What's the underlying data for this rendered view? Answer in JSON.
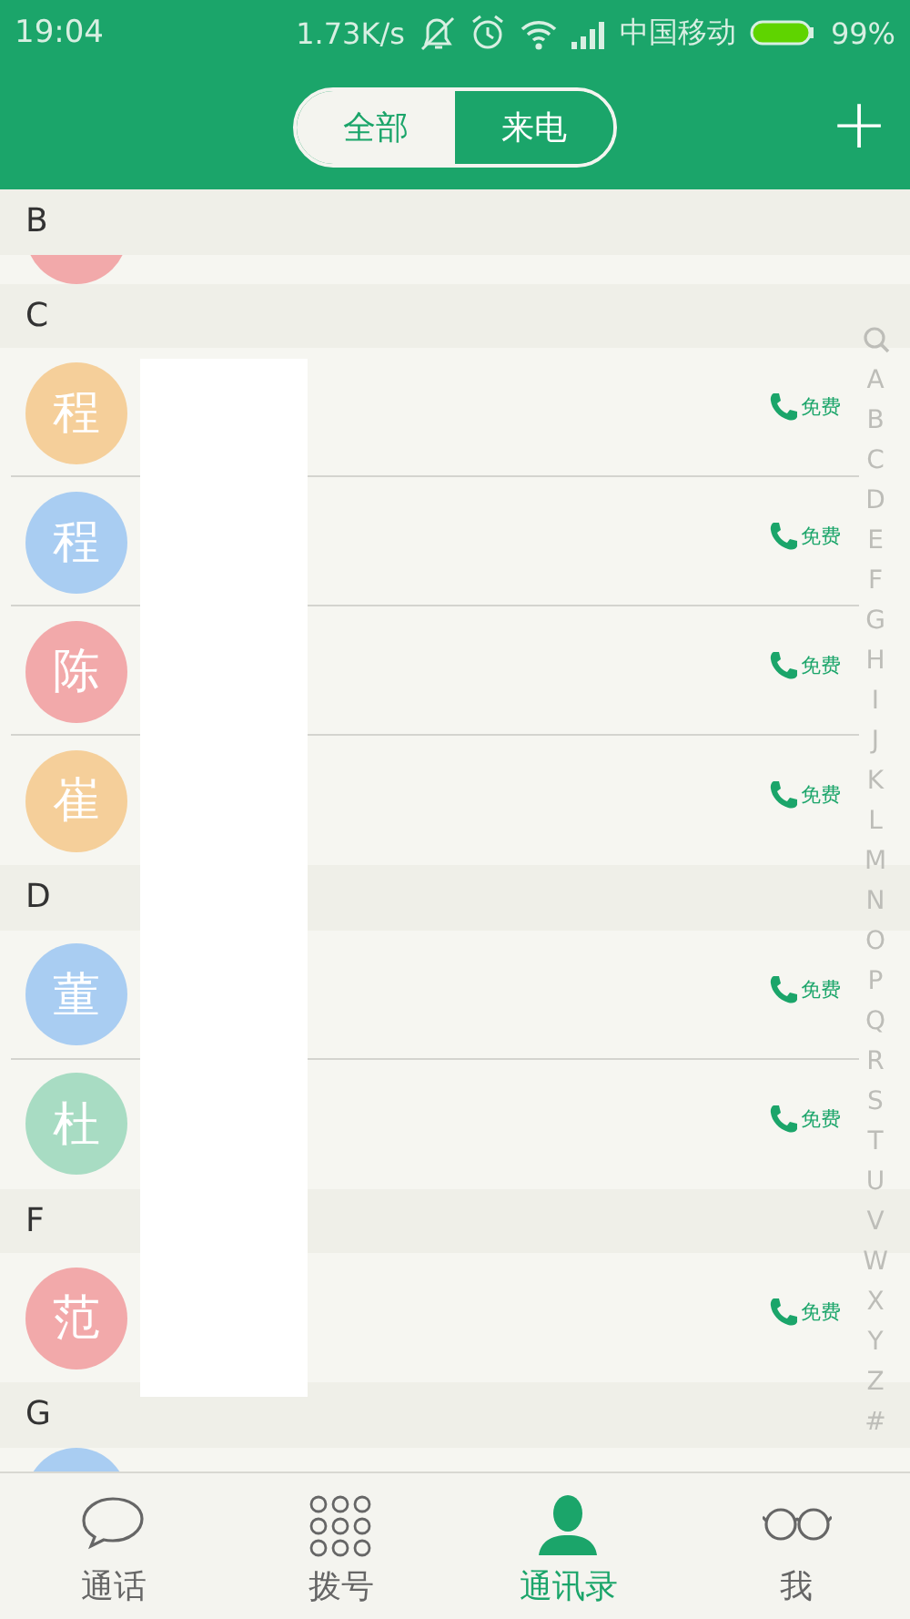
{
  "status_bar": {
    "time": "19:04",
    "speed": "1.73K/s",
    "carrier": "中国移动",
    "battery": "99%"
  },
  "header": {
    "tabs": [
      {
        "label": "全部",
        "selected": true
      },
      {
        "label": "来电",
        "selected": false
      }
    ],
    "add": "+"
  },
  "sections": [
    {
      "letter": "B",
      "rows": [
        {
          "kind": "cut_top",
          "color": "#f2a9aa"
        }
      ]
    },
    {
      "letter": "C",
      "rows": [
        {
          "kind": "contact",
          "avatar": "程",
          "color": "#f5cf9a",
          "free": "免费"
        },
        {
          "kind": "contact",
          "avatar": "程",
          "color": "#a9cdf2",
          "free": "免费"
        },
        {
          "kind": "contact",
          "avatar": "陈",
          "color": "#f2a9aa",
          "free": "免费"
        },
        {
          "kind": "contact",
          "avatar": "崔",
          "color": "#f5cf9a",
          "free": "免费"
        }
      ]
    },
    {
      "letter": "D",
      "rows": [
        {
          "kind": "contact",
          "avatar": "董",
          "color": "#a9cdf2",
          "free": "免费"
        },
        {
          "kind": "contact",
          "avatar": "杜",
          "color": "#a8dcc3",
          "free": "免费"
        }
      ]
    },
    {
      "letter": "F",
      "rows": [
        {
          "kind": "contact",
          "avatar": "范",
          "color": "#f2a9aa",
          "free": "免费"
        }
      ]
    },
    {
      "letter": "G",
      "rows": [
        {
          "kind": "cut_bottom",
          "color": "#a9cdf2"
        }
      ]
    }
  ],
  "index": [
    "A",
    "B",
    "C",
    "D",
    "E",
    "F",
    "G",
    "H",
    "I",
    "J",
    "K",
    "L",
    "M",
    "N",
    "O",
    "P",
    "Q",
    "R",
    "S",
    "T",
    "U",
    "V",
    "W",
    "X",
    "Y",
    "Z",
    "#"
  ],
  "nav": [
    {
      "label": "通话",
      "kind": "chat",
      "selected": false
    },
    {
      "label": "拨号",
      "kind": "dial",
      "selected": false
    },
    {
      "label": "通讯录",
      "kind": "contacts",
      "selected": true
    },
    {
      "label": "我",
      "kind": "me",
      "selected": false
    }
  ]
}
